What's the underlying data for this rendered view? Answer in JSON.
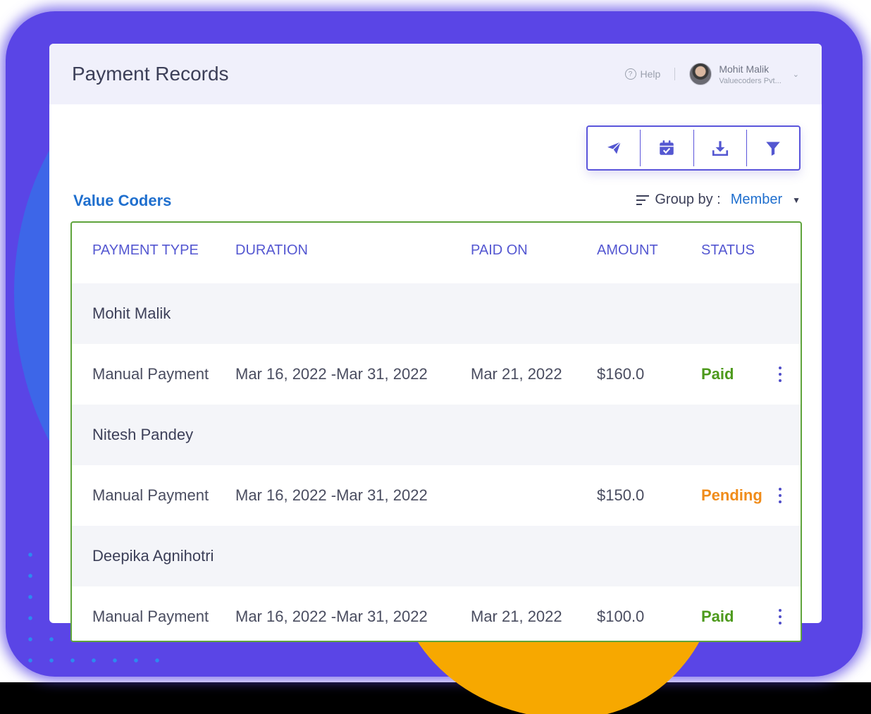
{
  "header": {
    "title": "Payment Records",
    "help_label": "Help",
    "user": {
      "name": "Mohit Malik",
      "org": "Valuecoders Pvt..."
    }
  },
  "toolbar": {
    "buttons": [
      {
        "icon": "send-icon"
      },
      {
        "icon": "calendar-check-icon"
      },
      {
        "icon": "download-icon"
      },
      {
        "icon": "filter-icon"
      }
    ]
  },
  "group": {
    "title": "Value Coders",
    "group_by_label": "Group by :",
    "group_by_value": "Member"
  },
  "table": {
    "columns": [
      "PAYMENT TYPE",
      "DURATION",
      "PAID ON",
      "AMOUNT",
      "STATUS"
    ],
    "groups": [
      {
        "member": "Mohit Malik",
        "row": {
          "type": "Manual Payment",
          "duration": "Mar 16, 2022 -Mar 31, 2022",
          "paid_on": "Mar 21, 2022",
          "amount": "$160.0",
          "status": "Paid"
        }
      },
      {
        "member": "Nitesh Pandey",
        "row": {
          "type": "Manual Payment",
          "duration": "Mar 16, 2022 -Mar 31, 2022",
          "paid_on": "",
          "amount": "$150.0",
          "status": "Pending"
        }
      },
      {
        "member": "Deepika Agnihotri",
        "row": {
          "type": "Manual Payment",
          "duration": "Mar 16, 2022 -Mar 31, 2022",
          "paid_on": "Mar 21, 2022",
          "amount": "$100.0",
          "status": "Paid"
        }
      }
    ]
  },
  "colors": {
    "accent": "#5457d1",
    "link_blue": "#1f6fce",
    "paid": "#4d9a1c",
    "pending": "#f08c1a",
    "table_border": "#5fa43c"
  }
}
